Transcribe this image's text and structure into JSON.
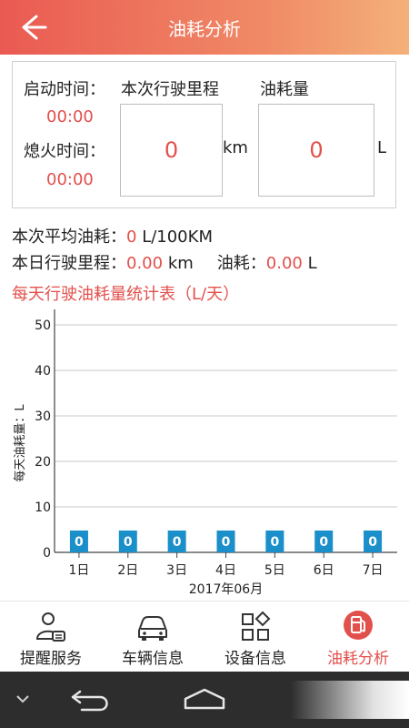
{
  "header": {
    "title": "油耗分析"
  },
  "panel": {
    "start_label": "启动时间：",
    "start_time": "00:00",
    "stop_label": "熄火时间：",
    "stop_time": "00:00",
    "trip_label": "本次行驶里程",
    "trip_value": "0",
    "trip_unit": "km",
    "fuel_label": "油耗量",
    "fuel_value": "0",
    "fuel_unit": "L"
  },
  "stats": {
    "avg_label": "本次平均油耗：",
    "avg_value": "0",
    "avg_unit": "L/100KM",
    "day_mileage_label": "本日行驶里程：",
    "day_mileage_value": "0.00",
    "day_mileage_unit": "km",
    "day_fuel_label": "油耗：",
    "day_fuel_value": "0.00",
    "day_fuel_unit": "L"
  },
  "section_title": "每天行驶油耗量统计表（L/天）",
  "chart_data": {
    "type": "bar",
    "categories": [
      "1日",
      "2日",
      "3日",
      "4日",
      "5日",
      "6日",
      "7日"
    ],
    "values": [
      0,
      0,
      0,
      0,
      0,
      0,
      0
    ],
    "xlabel": "2017年06月",
    "ylabel": "每天油耗量：L",
    "ylim": [
      0,
      50
    ],
    "yticks": [
      0,
      10,
      20,
      30,
      40,
      50
    ],
    "grid": true,
    "bar_color": "#1a8fc9",
    "value_label_color": "#ffffff"
  },
  "nav": {
    "items": [
      {
        "label": "提醒服务",
        "icon": "person-card-icon",
        "active": false
      },
      {
        "label": "车辆信息",
        "icon": "car-icon",
        "active": false
      },
      {
        "label": "设备信息",
        "icon": "device-grid-icon",
        "active": false
      },
      {
        "label": "油耗分析",
        "icon": "fuel-pump-icon",
        "active": true
      }
    ]
  },
  "colors": {
    "accent": "#e2504c",
    "header_start": "#ea5a52",
    "header_end": "#f4b17a",
    "bar": "#1a8fc9"
  }
}
